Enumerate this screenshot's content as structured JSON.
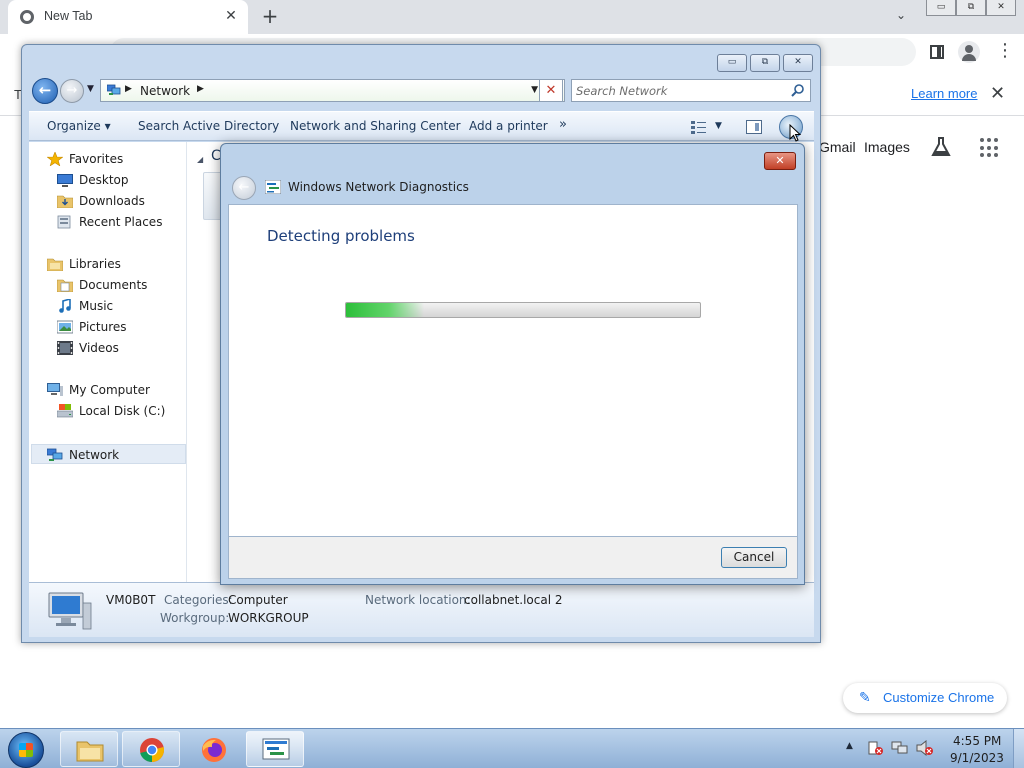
{
  "chrome": {
    "tab_title": "New Tab",
    "tab_close": "✕",
    "new_tab": "+",
    "tab_dropdown": "⌄",
    "window_buttons": [
      "▭",
      "⧉",
      "✕"
    ],
    "infobar_truncated": "T",
    "learn_more": "Learn more",
    "infobar_close": "✕",
    "menu_dots": "⋮",
    "ntp_links": {
      "gmail": "Gmail",
      "images": "Images"
    },
    "customize_chrome": "Customize Chrome"
  },
  "explorer": {
    "caption_buttons": [
      "▭",
      "⧉",
      "✕"
    ],
    "address": {
      "location": "Network"
    },
    "search": {
      "placeholder": "Search Network"
    },
    "commands": {
      "organize": "Organize ▾",
      "search_ad": "Search Active Directory",
      "network_sharing": "Network and Sharing Center",
      "add_printer": "Add a printer",
      "more": "»"
    },
    "nav": {
      "favorites": "Favorites",
      "desktop": "Desktop",
      "downloads": "Downloads",
      "recent_places": "Recent Places",
      "libraries": "Libraries",
      "documents": "Documents",
      "music": "Music",
      "pictures": "Pictures",
      "videos": "Videos",
      "my_computer": "My Computer",
      "local_disk": "Local Disk (C:)",
      "network": "Network"
    },
    "content_header": "C",
    "details": {
      "name": "VM0B0T",
      "categories_label": "Categories:",
      "categories_value": "Computer",
      "workgroup_label": "Workgroup:",
      "workgroup_value": "WORKGROUP",
      "network_location_label": "Network location:",
      "network_location_value": "collabnet.local  2"
    }
  },
  "diagnostics": {
    "close": "✕",
    "title": "Windows Network Diagnostics",
    "heading": "Detecting problems",
    "progress_fraction": 0.22,
    "cancel": "Cancel"
  },
  "taskbar": {
    "tray_arrow": "▲",
    "clock_time": "4:55 PM",
    "clock_date": "9/1/2023"
  },
  "colors": {
    "chrome_tabstrip": "#dee1e6",
    "link_blue": "#1a73e8",
    "aero_frame": "#c7d9ee",
    "heading_blue": "#1e3f7a",
    "progress_green": "#2cbf3a"
  },
  "icons": [
    "chrome-icon",
    "profile-icon",
    "side-panel-icon",
    "labs-icon",
    "apps-grid-icon",
    "pencil-icon",
    "back-arrow-icon",
    "forward-arrow-icon",
    "network-icon",
    "search-icon",
    "help-icon",
    "star-icon",
    "folder-icon",
    "computer-icon",
    "drive-icon",
    "start-orb-icon",
    "firefox-icon",
    "diagnostics-icon"
  ]
}
